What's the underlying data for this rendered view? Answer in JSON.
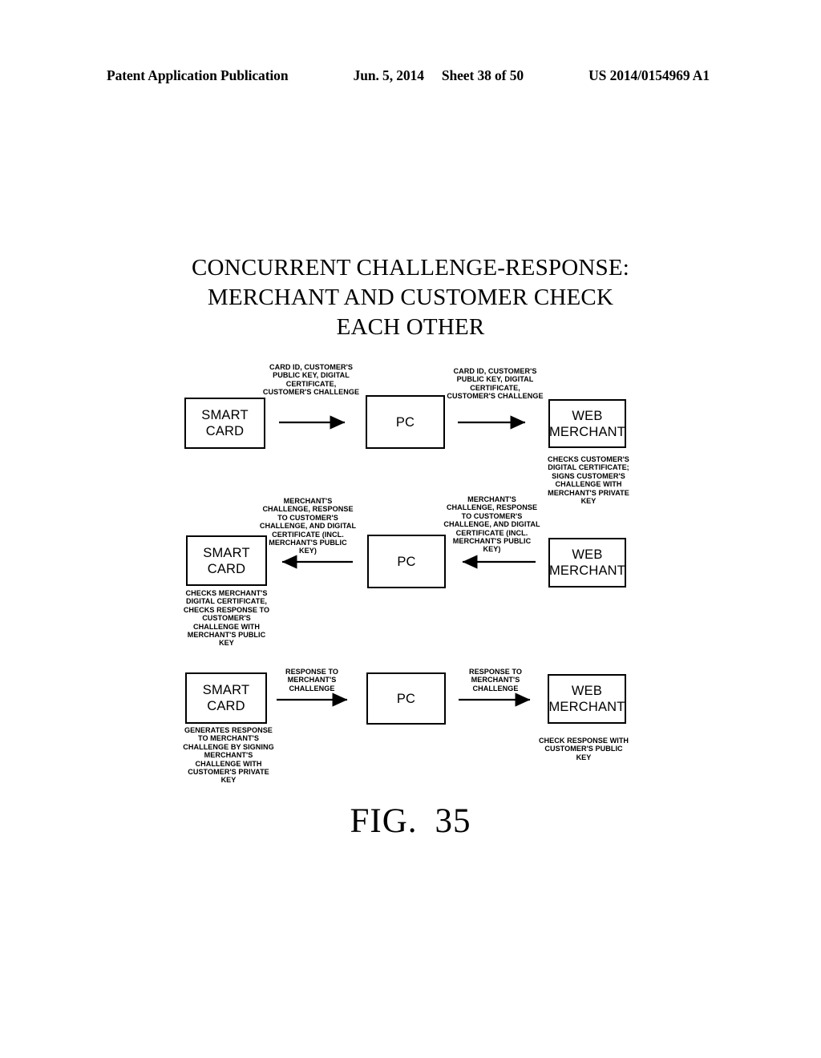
{
  "header": {
    "publication": "Patent Application Publication",
    "date": "Jun. 5, 2014",
    "sheet": "Sheet 38 of 50",
    "patent_number": "US 2014/0154969 A1"
  },
  "figure": {
    "title_line1": "CONCURRENT CHALLENGE-RESPONSE:",
    "title_line2": "MERCHANT AND CUSTOMER CHECK",
    "title_line3": "EACH OTHER",
    "caption_label": "FIG.",
    "caption_number": "35"
  },
  "nodes": {
    "r1_smartcard": "SMART\nCARD",
    "r1_pc": "PC",
    "r1_web": "WEB\nMERCHANT",
    "r2_smartcard": "SMART\nCARD",
    "r2_pc": "PC",
    "r2_web": "WEB\nMERCHANT",
    "r3_smartcard": "SMART\nCARD",
    "r3_pc": "PC",
    "r3_web": "WEB\nMERCHANT"
  },
  "edge_labels": {
    "r1_left": "CARD ID, CUSTOMER'S\nPUBLIC KEY, DIGITAL\nCERTIFICATE,\nCUSTOMER'S CHALLENGE",
    "r1_right": "CARD ID, CUSTOMER'S\nPUBLIC KEY, DIGITAL\nCERTIFICATE,\nCUSTOMER'S CHALLENGE",
    "r2_left": "MERCHANT'S\nCHALLENGE, RESPONSE\nTO CUSTOMER'S\nCHALLENGE, AND DIGITAL\nCERTIFICATE (INCL.\nMERCHANT'S PUBLIC\nKEY)",
    "r2_right": "MERCHANT'S\nCHALLENGE, RESPONSE\nTO CUSTOMER'S\nCHALLENGE, AND DIGITAL\nCERTIFICATE (INCL.\nMERCHANT'S PUBLIC\nKEY)",
    "r3_left": "RESPONSE TO\nMERCHANT'S\nCHALLENGE",
    "r3_right": "RESPONSE TO\nMERCHANT'S\nCHALLENGE"
  },
  "notes": {
    "merchant_checks": "CHECKS CUSTOMER'S\nDIGITAL CERTIFICATE;\nSIGNS CUSTOMER'S\nCHALLENGE WITH\nMERCHANT'S PRIVATE\nKEY",
    "card_checks": "CHECKS MERCHANT'S\nDIGITAL CERTIFICATE,\nCHECKS RESPONSE TO\nCUSTOMER'S\nCHALLENGE WITH\nMERCHANT'S PUBLIC\nKEY",
    "card_generates": "GENERATES RESPONSE\nTO MERCHANT'S\nCHALLENGE BY SIGNING\nMERCHANT'S\nCHALLENGE WITH\nCUSTOMER'S PRIVATE\nKEY",
    "merchant_verifies": "CHECK RESPONSE WITH\nCUSTOMER'S PUBLIC\nKEY"
  },
  "colors": {
    "ink": "#000000",
    "paper": "#ffffff"
  }
}
